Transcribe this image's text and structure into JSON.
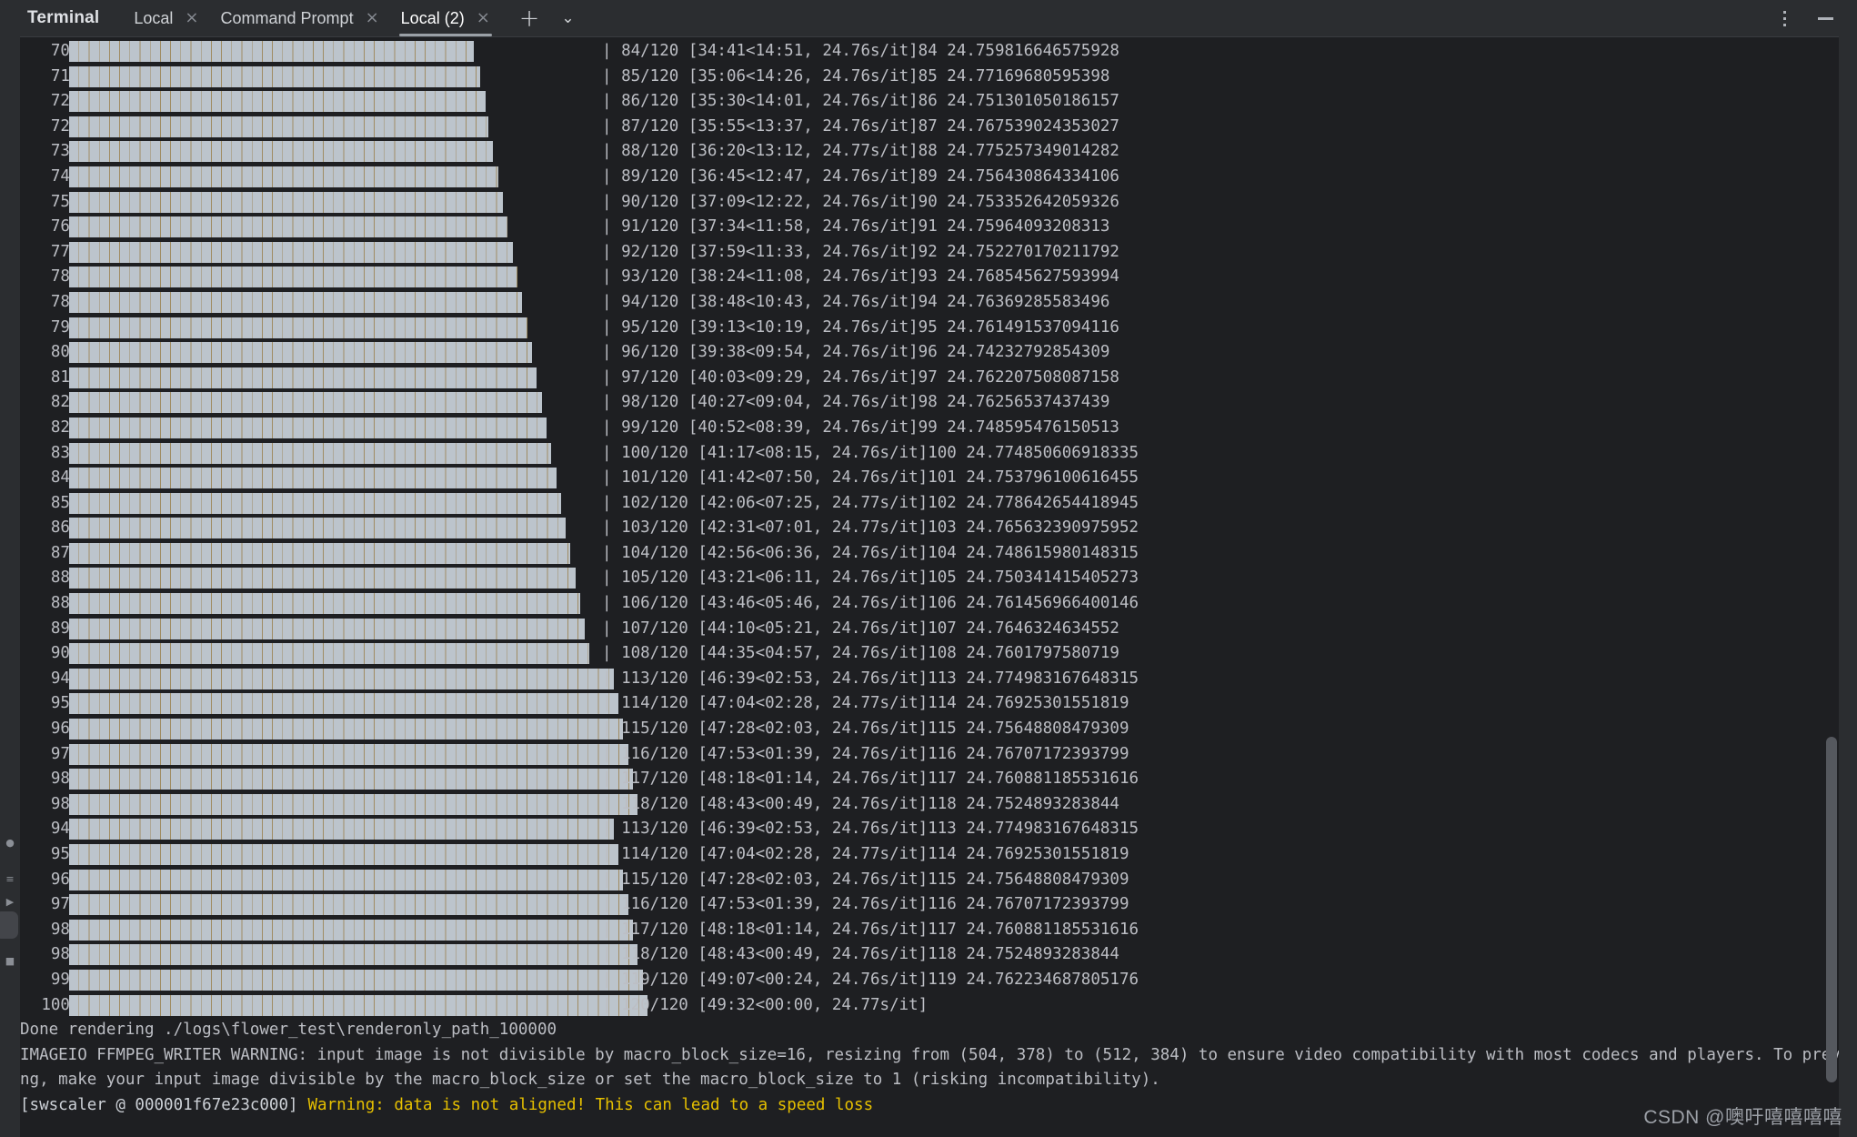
{
  "window": {
    "title": "Terminal",
    "more_options_icon": "kebab-vertical-icon",
    "minimize_icon": "minimize-icon"
  },
  "tabs": [
    {
      "label": "Local",
      "close_icon": "close-icon",
      "active": false
    },
    {
      "label": "Command Prompt",
      "close_icon": "close-icon",
      "active": false
    },
    {
      "label": "Local (2)",
      "close_icon": "close-icon",
      "active": true
    }
  ],
  "tab_actions": {
    "add_label": "+",
    "add_icon": "plus-icon",
    "dropdown_label": "⌄",
    "dropdown_icon": "chevron-down-icon"
  },
  "left_strip": {
    "icons": [
      "tool-window-icon",
      "structure-icon",
      "run-icon",
      "terminal-icon",
      "services-icon"
    ]
  },
  "terminal": {
    "font_color": "#bcbec4",
    "background": "#1e1f22",
    "bar_color": "#bcc4cc",
    "bar_separator_color": "#a08c63",
    "warning_color": "#e6c000",
    "progress_lines": [
      {
        "pct": "70%|",
        "bar_pct": 70,
        "tail": "| 84/120 [34:41<14:51, 24.76s/it]84 24.759816646575928"
      },
      {
        "pct": "71%|",
        "bar_pct": 71,
        "tail": "| 85/120 [35:06<14:26, 24.76s/it]85 24.77169680595398"
      },
      {
        "pct": "72%|",
        "bar_pct": 72,
        "tail": "| 86/120 [35:30<14:01, 24.76s/it]86 24.751301050186157"
      },
      {
        "pct": "72%|",
        "bar_pct": 72.5,
        "tail": "| 87/120 [35:55<13:37, 24.76s/it]87 24.767539024353027"
      },
      {
        "pct": "73%|",
        "bar_pct": 73.3,
        "tail": "| 88/120 [36:20<13:12, 24.77s/it]88 24.775257349014282"
      },
      {
        "pct": "74%|",
        "bar_pct": 74.2,
        "tail": "| 89/120 [36:45<12:47, 24.76s/it]89 24.756430864334106"
      },
      {
        "pct": "75%|",
        "bar_pct": 75,
        "tail": "| 90/120 [37:09<12:22, 24.76s/it]90 24.753352642059326"
      },
      {
        "pct": "76%|",
        "bar_pct": 75.8,
        "tail": "| 91/120 [37:34<11:58, 24.76s/it]91 24.75964093208313"
      },
      {
        "pct": "77%|",
        "bar_pct": 76.7,
        "tail": "| 92/120 [37:59<11:33, 24.76s/it]92 24.752270170211792"
      },
      {
        "pct": "78%|",
        "bar_pct": 77.5,
        "tail": "| 93/120 [38:24<11:08, 24.76s/it]93 24.768545627593994"
      },
      {
        "pct": "78%|",
        "bar_pct": 78.3,
        "tail": "| 94/120 [38:48<10:43, 24.76s/it]94 24.76369285583496"
      },
      {
        "pct": "79%|",
        "bar_pct": 79.2,
        "tail": "| 95/120 [39:13<10:19, 24.76s/it]95 24.761491537094116"
      },
      {
        "pct": "80%|",
        "bar_pct": 80,
        "tail": "| 96/120 [39:38<09:54, 24.76s/it]96 24.74232792854309"
      },
      {
        "pct": "81%|",
        "bar_pct": 80.8,
        "tail": "| 97/120 [40:03<09:29, 24.76s/it]97 24.762207508087158"
      },
      {
        "pct": "82%|",
        "bar_pct": 81.7,
        "tail": "| 98/120 [40:27<09:04, 24.76s/it]98 24.76256537437439"
      },
      {
        "pct": "82%|",
        "bar_pct": 82.5,
        "tail": "| 99/120 [40:52<08:39, 24.76s/it]99 24.748595476150513"
      },
      {
        "pct": "83%|",
        "bar_pct": 83.3,
        "tail": "| 100/120 [41:17<08:15, 24.76s/it]100 24.774850606918335"
      },
      {
        "pct": "84%|",
        "bar_pct": 84.2,
        "tail": "| 101/120 [41:42<07:50, 24.76s/it]101 24.753796100616455"
      },
      {
        "pct": "85%|",
        "bar_pct": 85,
        "tail": "| 102/120 [42:06<07:25, 24.77s/it]102 24.778642654418945"
      },
      {
        "pct": "86%|",
        "bar_pct": 85.8,
        "tail": "| 103/120 [42:31<07:01, 24.77s/it]103 24.765632390975952"
      },
      {
        "pct": "87%|",
        "bar_pct": 86.7,
        "tail": "| 104/120 [42:56<06:36, 24.76s/it]104 24.748615980148315"
      },
      {
        "pct": "88%|",
        "bar_pct": 87.5,
        "tail": "| 105/120 [43:21<06:11, 24.76s/it]105 24.750341415405273"
      },
      {
        "pct": "88%|",
        "bar_pct": 88.3,
        "tail": "| 106/120 [43:46<05:46, 24.76s/it]106 24.761456966400146"
      },
      {
        "pct": "89%|",
        "bar_pct": 89.2,
        "tail": "| 107/120 [44:10<05:21, 24.76s/it]107 24.7646324634552"
      },
      {
        "pct": "90%|",
        "bar_pct": 90,
        "tail": "| 108/120 [44:35<04:57, 24.76s/it]108 24.7601797580719"
      },
      {
        "pct": "94%|",
        "bar_pct": 94.2,
        "tail": "| 113/120 [46:39<02:53, 24.76s/it]113 24.774983167648315"
      },
      {
        "pct": "95%|",
        "bar_pct": 95,
        "tail": "| 114/120 [47:04<02:28, 24.77s/it]114 24.76925301551819"
      },
      {
        "pct": "96%|",
        "bar_pct": 95.8,
        "tail": "| 115/120 [47:28<02:03, 24.76s/it]115 24.75648808479309"
      },
      {
        "pct": "97%|",
        "bar_pct": 96.7,
        "tail": "| 116/120 [47:53<01:39, 24.76s/it]116 24.76707172393799"
      },
      {
        "pct": "98%|",
        "bar_pct": 97.5,
        "tail": "| 117/120 [48:18<01:14, 24.76s/it]117 24.760881185531616"
      },
      {
        "pct": "98%|",
        "bar_pct": 98.3,
        "tail": "| 118/120 [48:43<00:49, 24.76s/it]118 24.7524893283844"
      },
      {
        "pct": "94%|",
        "bar_pct": 94.2,
        "tail": "| 113/120 [46:39<02:53, 24.76s/it]113 24.774983167648315"
      },
      {
        "pct": "95%|",
        "bar_pct": 95,
        "tail": "| 114/120 [47:04<02:28, 24.77s/it]114 24.76925301551819"
      },
      {
        "pct": "96%|",
        "bar_pct": 95.8,
        "tail": "| 115/120 [47:28<02:03, 24.76s/it]115 24.75648808479309"
      },
      {
        "pct": "97%|",
        "bar_pct": 96.7,
        "tail": "| 116/120 [47:53<01:39, 24.76s/it]116 24.76707172393799"
      },
      {
        "pct": "98%|",
        "bar_pct": 97.5,
        "tail": "| 117/120 [48:18<01:14, 24.76s/it]117 24.760881185531616"
      },
      {
        "pct": "98%|",
        "bar_pct": 98.3,
        "tail": "| 118/120 [48:43<00:49, 24.76s/it]118 24.7524893283844"
      },
      {
        "pct": "99%|",
        "bar_pct": 99.2,
        "tail": "| 119/120 [49:07<00:24, 24.76s/it]119 24.762234687805176"
      },
      {
        "pct": "100%|",
        "bar_pct": 100,
        "tail": "| 120/120 [49:32<00:00, 24.77s/it]"
      }
    ],
    "output_lines": [
      {
        "text": "Done rendering ./logs\\flower_test\\renderonly_path_100000",
        "color": "plain"
      },
      {
        "text": "IMAGEIO FFMPEG_WRITER WARNING: input image is not divisible by macro_block_size=16, resizing from (504, 378) to (512, 384) to ensure video compatibility with most codecs and players. To prevent resizi",
        "color": "plain"
      },
      {
        "text": "ng, make your input image divisible by the macro_block_size or set the macro_block_size to 1 (risking incompatibility).",
        "color": "plain"
      }
    ],
    "swscaler_line": {
      "prefix": "[swscaler @ 000001f67e23c000] ",
      "warning": "Warning: data is not aligned! This can lead to a speed loss"
    }
  },
  "scrollbar": {
    "name": "vertical-scrollbar"
  },
  "watermark": {
    "text": "CSDN @噢吁嘻嘻嘻嘻"
  }
}
